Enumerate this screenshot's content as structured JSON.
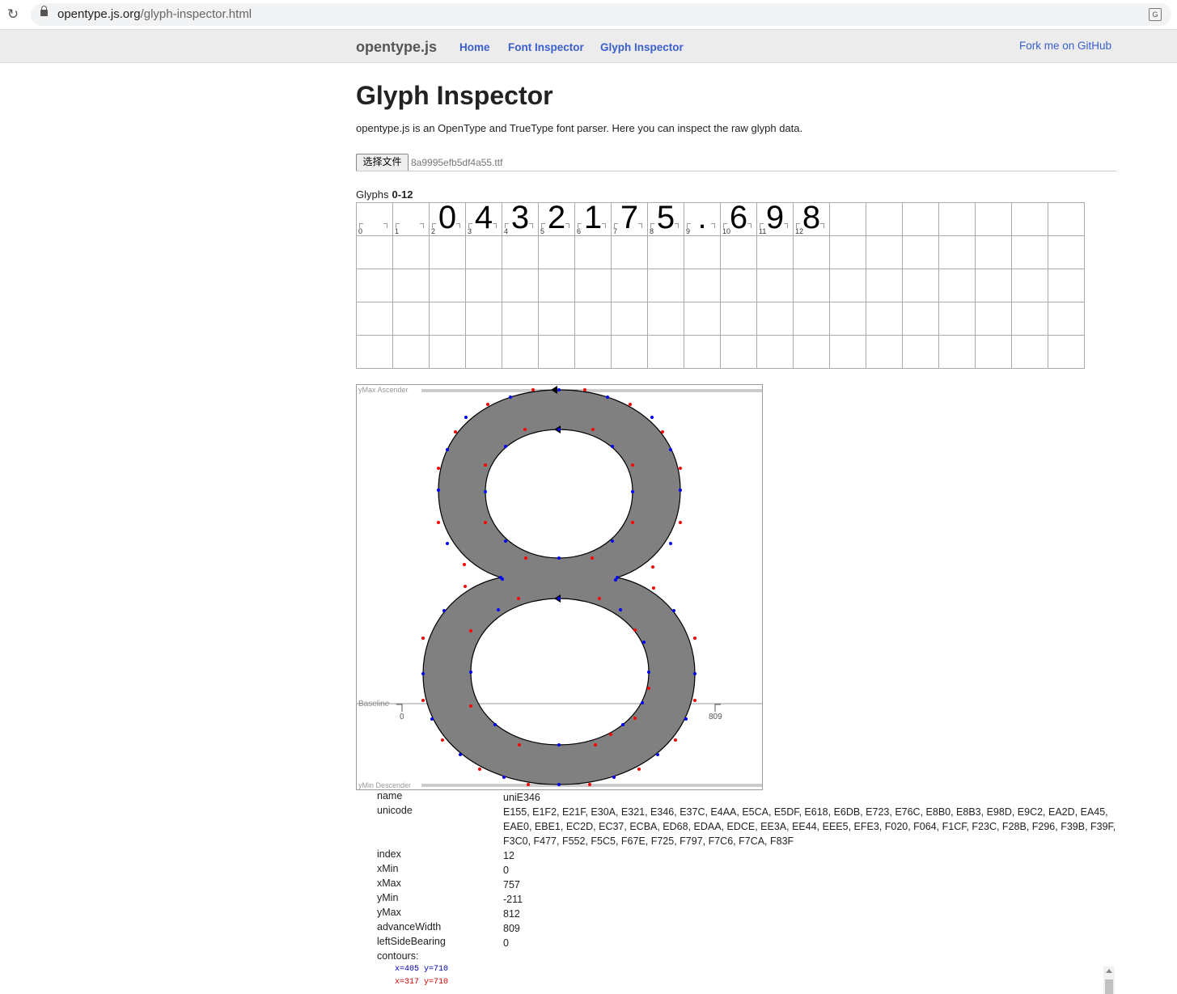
{
  "browser": {
    "url_host": "opentype.js.org",
    "url_path": "/glyph-inspector.html"
  },
  "nav": {
    "brand": "opentype.js",
    "links": [
      "Home",
      "Font Inspector",
      "Glyph Inspector"
    ],
    "fork": "Fork me on GitHub"
  },
  "page": {
    "title": "Glyph Inspector",
    "description": "opentype.js is an OpenType and TrueType font parser. Here you can inspect the raw glyph data.",
    "file_button": "选择文件",
    "file_name": "8a9995efb5df4a55.ttf",
    "glyphs_label": "Glyphs",
    "glyphs_range": "0-12"
  },
  "glyph_cells": [
    {
      "index": "0",
      "char": ""
    },
    {
      "index": "1",
      "char": ""
    },
    {
      "index": "2",
      "char": "0"
    },
    {
      "index": "3",
      "char": "4"
    },
    {
      "index": "4",
      "char": "3"
    },
    {
      "index": "5",
      "char": "2"
    },
    {
      "index": "6",
      "char": "1"
    },
    {
      "index": "7",
      "char": "7"
    },
    {
      "index": "8",
      "char": "5"
    },
    {
      "index": "9",
      "char": "."
    },
    {
      "index": "10",
      "char": "6"
    },
    {
      "index": "11",
      "char": "9"
    },
    {
      "index": "12",
      "char": "8"
    }
  ],
  "glyph_view": {
    "top_labels": "yMax Ascender",
    "baseline_label": "Baseline",
    "bottom_labels": "yMin Descender",
    "left_metric": "0",
    "right_metric": "809",
    "fill": "#808080",
    "on_curve_color": "#0000ff",
    "off_curve_color": "#ff0000"
  },
  "info": {
    "name_k": "name",
    "name_v": "uniE346",
    "unicode_k": "unicode",
    "unicode_v": "E155, E1F2, E21F, E30A, E321, E346, E37C, E4AA, E5CA, E5DF, E618, E6DB, E723, E76C, E8B0, E8B3, E98D, E9C2, EA2D, EA45, EAE0, EBE1, EC2D, EC37, ECBA, ED68, EDAA, EDCE, EE3A, EE44, EEE5, EFE3, F020, F064, F1CF, F23C, F28B, F296, F39B, F39F, F3C0, F477, F552, F5C5, F67E, F725, F797, F7C6, F7CA, F83F",
    "index_k": "index",
    "index_v": "12",
    "xmin_k": "xMin",
    "xmin_v": "0",
    "xmax_k": "xMax",
    "xmax_v": "757",
    "ymin_k": "yMin",
    "ymin_v": "-211",
    "ymax_k": "yMax",
    "ymax_v": "812",
    "aw_k": "advanceWidth",
    "aw_v": "809",
    "lsb_k": "leftSideBearing",
    "lsb_v": "0",
    "contours_k": "contours:",
    "pt1": "x=405 y=710",
    "pt2": "x=317 y=710"
  }
}
